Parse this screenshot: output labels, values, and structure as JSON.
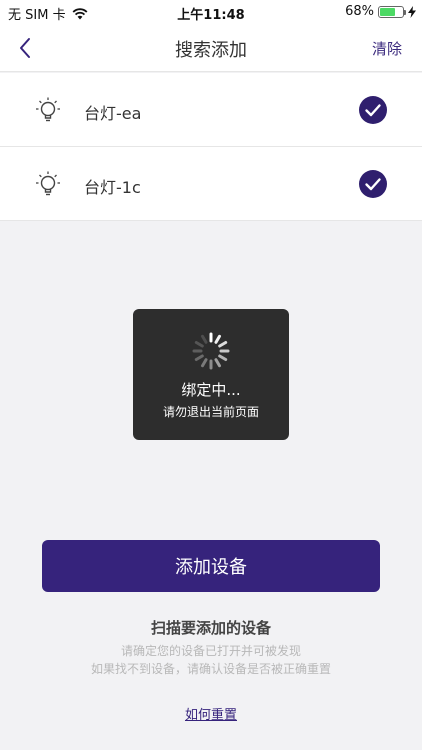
{
  "status_bar": {
    "carrier": "无 SIM 卡",
    "time": "上午11:48",
    "battery": "68%",
    "battery_level": 0.68,
    "icons": [
      "wifi-icon",
      "battery-icon",
      "charging-bolt-icon"
    ]
  },
  "nav": {
    "title": "搜索添加",
    "clear_label": "清除",
    "back_icon": "chevron-left-icon"
  },
  "devices": [
    {
      "label": "台灯-ea",
      "checked": true,
      "icon": "bulb-icon"
    },
    {
      "label": "台灯-1c",
      "checked": true,
      "icon": "bulb-icon"
    }
  ],
  "toast": {
    "title": "绑定中...",
    "subtitle": "请勿退出当前页面"
  },
  "actions": {
    "add_button": "添加设备"
  },
  "instructions": {
    "title": "扫描要添加的设备",
    "line1": "请确定您的设备已打开并可被发现",
    "line2": "如果找不到设备，请确认设备是否被正确重置",
    "reset_link": "如何重置"
  },
  "colors": {
    "accent": "#36237c",
    "check": "#2f1f6e",
    "battery": "#4cd964"
  }
}
